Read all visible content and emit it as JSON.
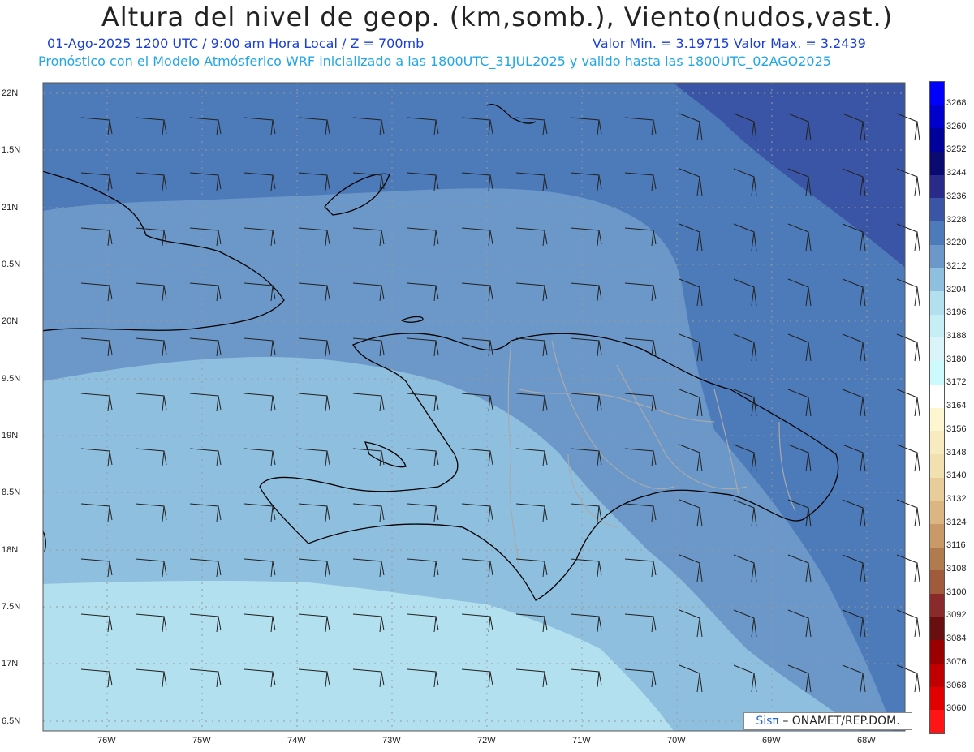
{
  "header": {
    "title": "Altura del nivel de geop. (km,somb.), Viento(nudos,vast.)",
    "line1_left": "01-Ago-2025  1200 UTC / 9:00 am Hora Local / Z = 700mb",
    "line1_right": "Valor Min. = 3.19715  Valor Max. = 3.2439",
    "line2": "Pronóstico con el Modelo Atmósferico WRF inicializado a las 1800UTC_31JUL2025 y valido hasta las  1800UTC_02AGO2025"
  },
  "axes": {
    "lat_labels": [
      "22N",
      "1.5N",
      "21N",
      "0.5N",
      "20N",
      "9.5N",
      "19N",
      "8.5N",
      "18N",
      "7.5N",
      "17N",
      "6.5N"
    ],
    "lon_labels": [
      "76W",
      "75W",
      "74W",
      "73W",
      "72W",
      "71W",
      "70W",
      "69W",
      "68W"
    ]
  },
  "colorbar": {
    "labels": [
      "3268",
      "3260",
      "3252",
      "3244",
      "3236",
      "3228",
      "3220",
      "3212",
      "3204",
      "3196",
      "3188",
      "3180",
      "3172",
      "3164",
      "3156",
      "3148",
      "3140",
      "3132",
      "3124",
      "3116",
      "3108",
      "3100",
      "3092",
      "3084",
      "3076",
      "3068",
      "3060"
    ],
    "colors": [
      "#0000ff",
      "#0000cc",
      "#00009a",
      "#0a0a70",
      "#2a2a8a",
      "#3b55a6",
      "#4d7ab8",
      "#6b98c8",
      "#8fbfdf",
      "#b3e0ee",
      "#c6eef5",
      "#daf4fa",
      "#cdfafd",
      "#ffffff",
      "#fdf6d0",
      "#f7ebbf",
      "#f1e1b0",
      "#e8cc99",
      "#dbb582",
      "#c99a68",
      "#b07c4f",
      "#a05a3c",
      "#8a2a2a",
      "#6a0f0f",
      "#9a0000",
      "#c00000",
      "#e00000",
      "#ff1515"
    ]
  },
  "map": {
    "field_colors": {
      "lowest": "#b3e0ee",
      "low": "#8fbfdf",
      "mid": "#6b98c8",
      "high": "#4d7ab8",
      "highest": "#3b55a6"
    }
  },
  "credit": {
    "sis": "Sisπ",
    "text": "– ONAMET/REP.DOM."
  }
}
